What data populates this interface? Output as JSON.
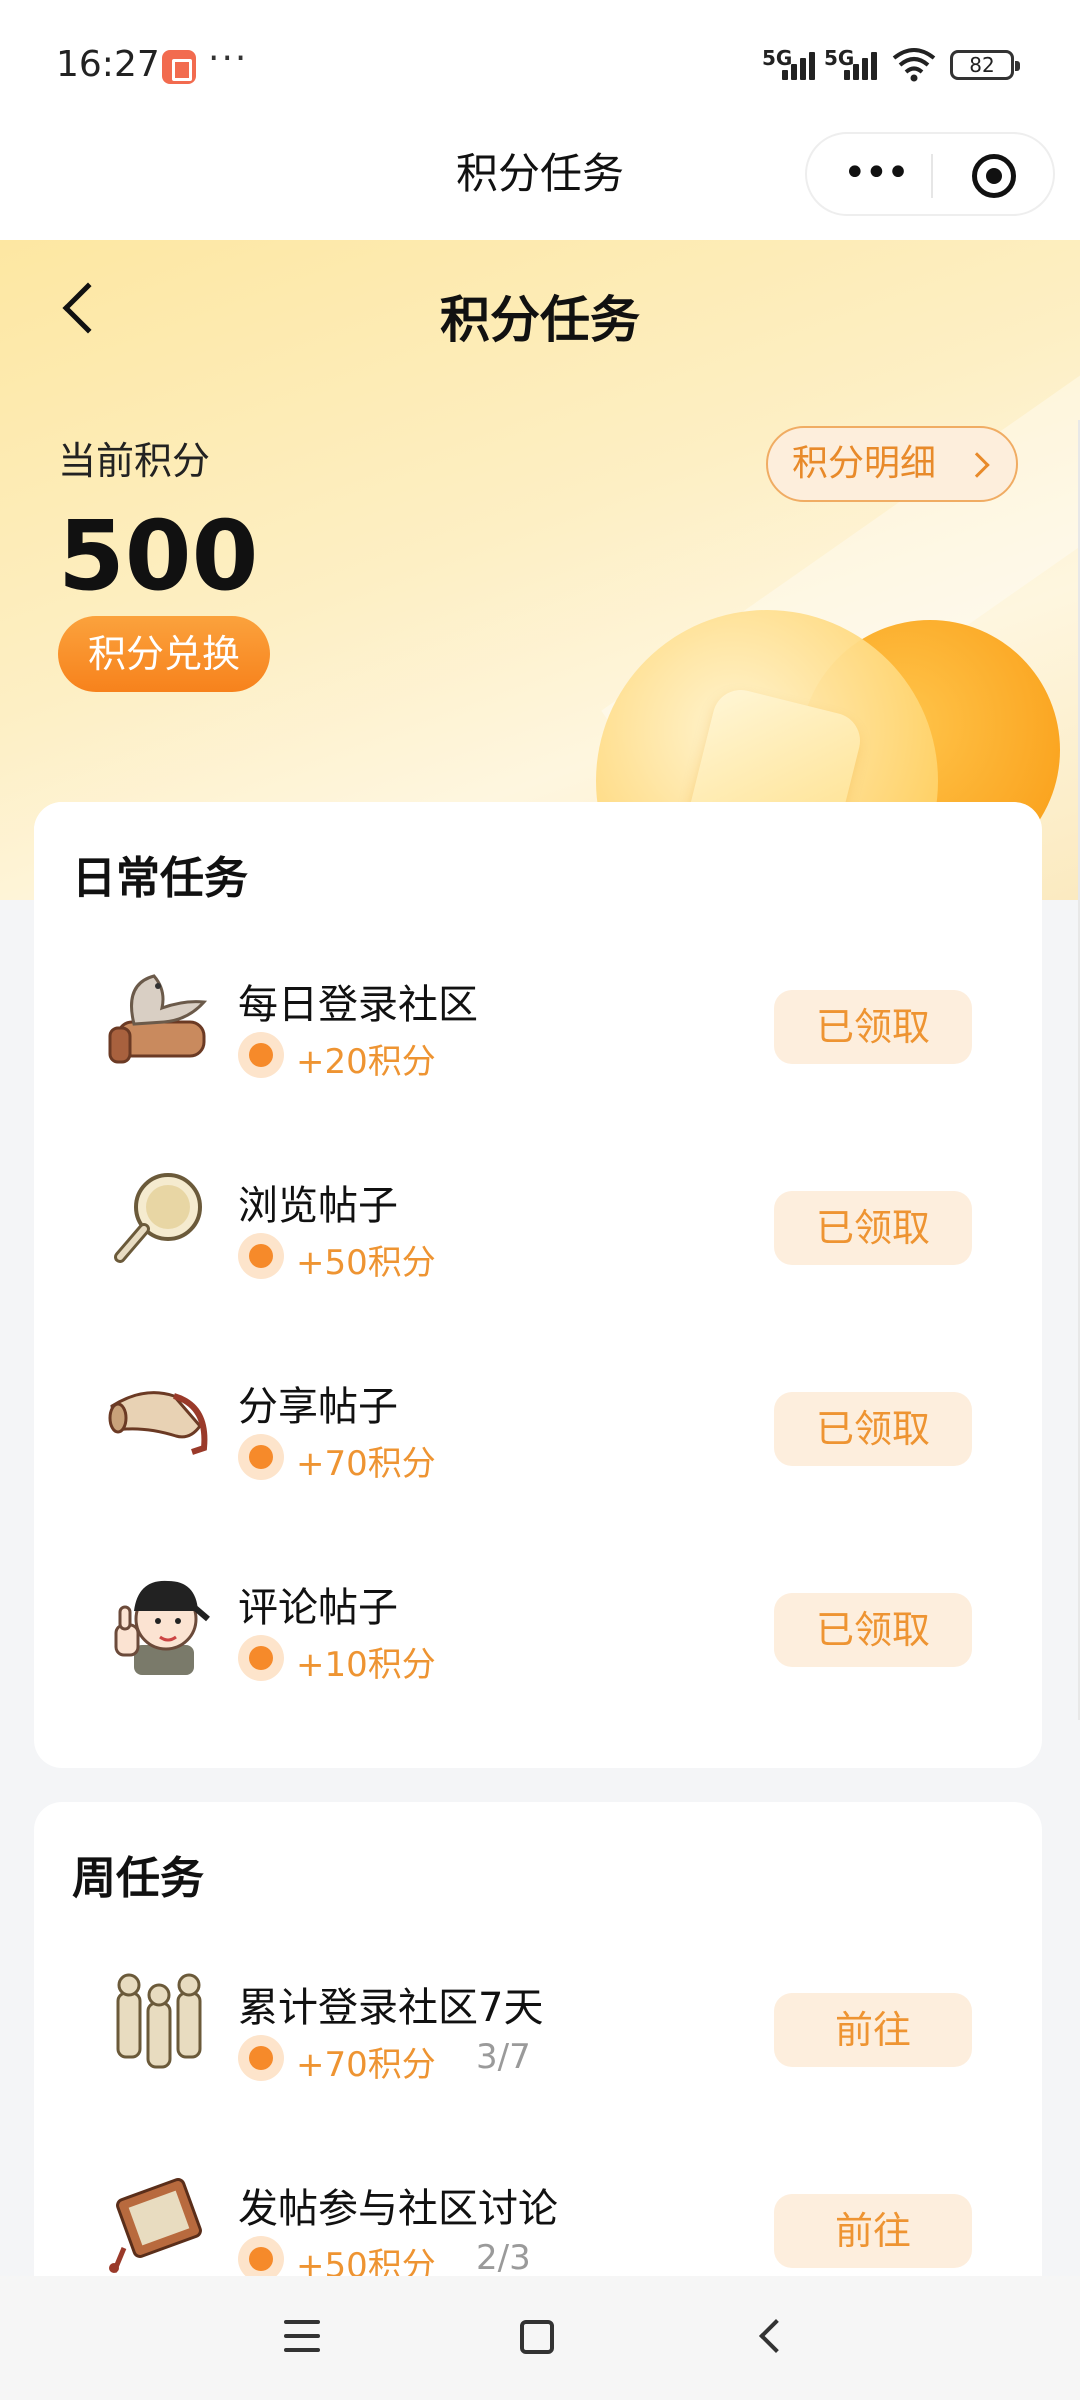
{
  "status_bar": {
    "time": "16:27",
    "dots": "···",
    "network_1": "5G",
    "network_2": "5G",
    "battery": "82"
  },
  "mini_program": {
    "title": "积分任务"
  },
  "header": {
    "title": "积分任务",
    "points_label": "当前积分",
    "points_value": "500",
    "exchange_label": "积分兑换",
    "detail_label": "积分明细"
  },
  "daily": {
    "title": "日常任务",
    "tasks": [
      {
        "name": "每日登录社区",
        "reward": "+20积分",
        "button": "已领取",
        "icon": "eagle-scroll-icon"
      },
      {
        "name": "浏览帖子",
        "reward": "+50积分",
        "button": "已领取",
        "icon": "magnifier-icon"
      },
      {
        "name": "分享帖子",
        "reward": "+70积分",
        "button": "已领取",
        "icon": "horn-icon"
      },
      {
        "name": "评论帖子",
        "reward": "+10积分",
        "button": "已领取",
        "icon": "thumbs-up-character-icon"
      }
    ]
  },
  "weekly": {
    "title": "周任务",
    "tasks": [
      {
        "name": "累计登录社区7天",
        "reward": "+70积分",
        "progress": "3/7",
        "button": "前往",
        "icon": "terracotta-warriors-icon"
      },
      {
        "name": "发帖参与社区讨论",
        "reward": "+50积分",
        "progress": "2/3",
        "button": "前往",
        "icon": "scroll-tassel-icon"
      }
    ]
  },
  "colors": {
    "accent": "#F7821C",
    "reward_text": "#EE9432",
    "button_bg": "#FDEEDD"
  }
}
